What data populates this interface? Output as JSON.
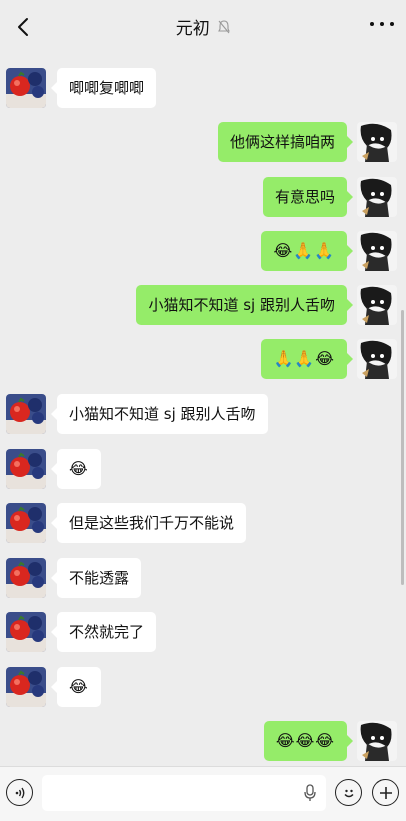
{
  "header": {
    "title": "元初"
  },
  "messages": [
    {
      "side": "in",
      "text": "",
      "type": "partial"
    },
    {
      "side": "in",
      "text": "唧唧复唧唧"
    },
    {
      "side": "out",
      "text": "他俩这样搞咱两"
    },
    {
      "side": "out",
      "text": "有意思吗"
    },
    {
      "side": "out",
      "text": "😂🙏🙏"
    },
    {
      "side": "out",
      "text": "小猫知不知道 sj 跟别人舌吻"
    },
    {
      "side": "out",
      "text": "🙏🙏😂"
    },
    {
      "side": "in",
      "text": "小猫知不知道 sj 跟别人舌吻"
    },
    {
      "side": "in",
      "text": "😂"
    },
    {
      "side": "in",
      "text": "但是这些我们千万不能说"
    },
    {
      "side": "in",
      "text": "不能透露"
    },
    {
      "side": "in",
      "text": "不然就完了"
    },
    {
      "side": "in",
      "text": "😂"
    },
    {
      "side": "out",
      "text": "😂😂😂"
    }
  ],
  "colors": {
    "outgoing": "#95ec69",
    "incoming": "#ffffff",
    "background": "#ededed"
  },
  "icons": {
    "back": "chevron-left-icon",
    "mute": "mute-bell-icon",
    "more": "more-dots-icon",
    "voice": "voice-icon",
    "mic": "mic-icon",
    "emoji": "emoji-icon",
    "add": "plus-circle-icon"
  }
}
